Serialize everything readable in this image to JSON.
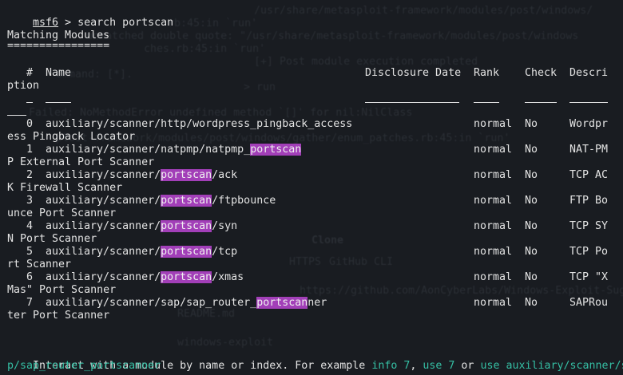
{
  "prompt": {
    "module": "msf6",
    "command": " > search portscan"
  },
  "heading": "Matching Modules",
  "heading_underline": "================",
  "columns": {
    "num": "#",
    "name": "Name",
    "date": "Disclosure Date",
    "rank": "Rank",
    "check": "Check",
    "desc": "Descri"
  },
  "header_wrap": "ption",
  "rows": [
    {
      "num": "0",
      "pre": "auxiliary/scanner/http/wordpress_pingback_access",
      "hl": "",
      "post": "",
      "rank": "normal",
      "check": "No",
      "desc": "Wordpr",
      "wrap": "ess Pingback Locator"
    },
    {
      "num": "1",
      "pre": "auxiliary/scanner/natpmp/natpmp_",
      "hl": "portscan",
      "post": "",
      "rank": "normal",
      "check": "No",
      "desc": "NAT-PM",
      "wrap": "P External Port Scanner"
    },
    {
      "num": "2",
      "pre": "auxiliary/scanner/",
      "hl": "portscan",
      "post": "/ack",
      "rank": "normal",
      "check": "No",
      "desc": "TCP AC",
      "wrap": "K Firewall Scanner"
    },
    {
      "num": "3",
      "pre": "auxiliary/scanner/",
      "hl": "portscan",
      "post": "/ftpbounce",
      "rank": "normal",
      "check": "No",
      "desc": "FTP Bo",
      "wrap": "unce Port Scanner"
    },
    {
      "num": "4",
      "pre": "auxiliary/scanner/",
      "hl": "portscan",
      "post": "/syn",
      "rank": "normal",
      "check": "No",
      "desc": "TCP SY",
      "wrap": "N Port Scanner"
    },
    {
      "num": "5",
      "pre": "auxiliary/scanner/",
      "hl": "portscan",
      "post": "/tcp",
      "rank": "normal",
      "check": "No",
      "desc": "TCP Po",
      "wrap": "rt Scanner"
    },
    {
      "num": "6",
      "pre": "auxiliary/scanner/",
      "hl": "portscan",
      "post": "/xmas",
      "rank": "normal",
      "check": "No",
      "desc": "TCP \"X",
      "wrap": "Mas\" Port Scanner"
    },
    {
      "num": "7",
      "pre": "auxiliary/scanner/sap/sap_router_",
      "hl": "portscan",
      "post": "ner",
      "rank": "normal",
      "check": "No",
      "desc": "SAPRou",
      "wrap": "ter Port Scanner"
    }
  ],
  "footer": {
    "text1": "Interact with a module by name or index. For example ",
    "info": "info 7",
    "sep": ", ",
    "use7": "use 7",
    "or": " or ",
    "use_path": "use auxiliary/scanner/sa",
    "wrap": "p/sap_router_portscanner"
  },
  "ghost_text": [
    "/usr/share/metasploit-framework/modules/post/windows/",
    "rb:45:in `run'",
    "unmatched double quote: \"/usr/share/metasploit-framework/modules/post/windows",
    "ches.rb:45:in `run'",
    "[+] Post module execution completed",
    "ommand: [*].",
    "> run",
    "Failed: NoMethodError undefined method `[]' for nil:NilClass",
    "ploit-framework/modules/post/windows/gather/enum_patches.rb:45:in `run'",
    "Clone",
    "HTTPS",
    "GitHub CLI",
    "https://github.com/AonCyberLabs/Windows-Exploit-Suggester",
    "README.md",
    "windows-exploit"
  ],
  "colors": {
    "background": "#191c21",
    "text": "#e3e3e3",
    "accent": "#35bfa4",
    "highlight": "#a23fb8"
  }
}
